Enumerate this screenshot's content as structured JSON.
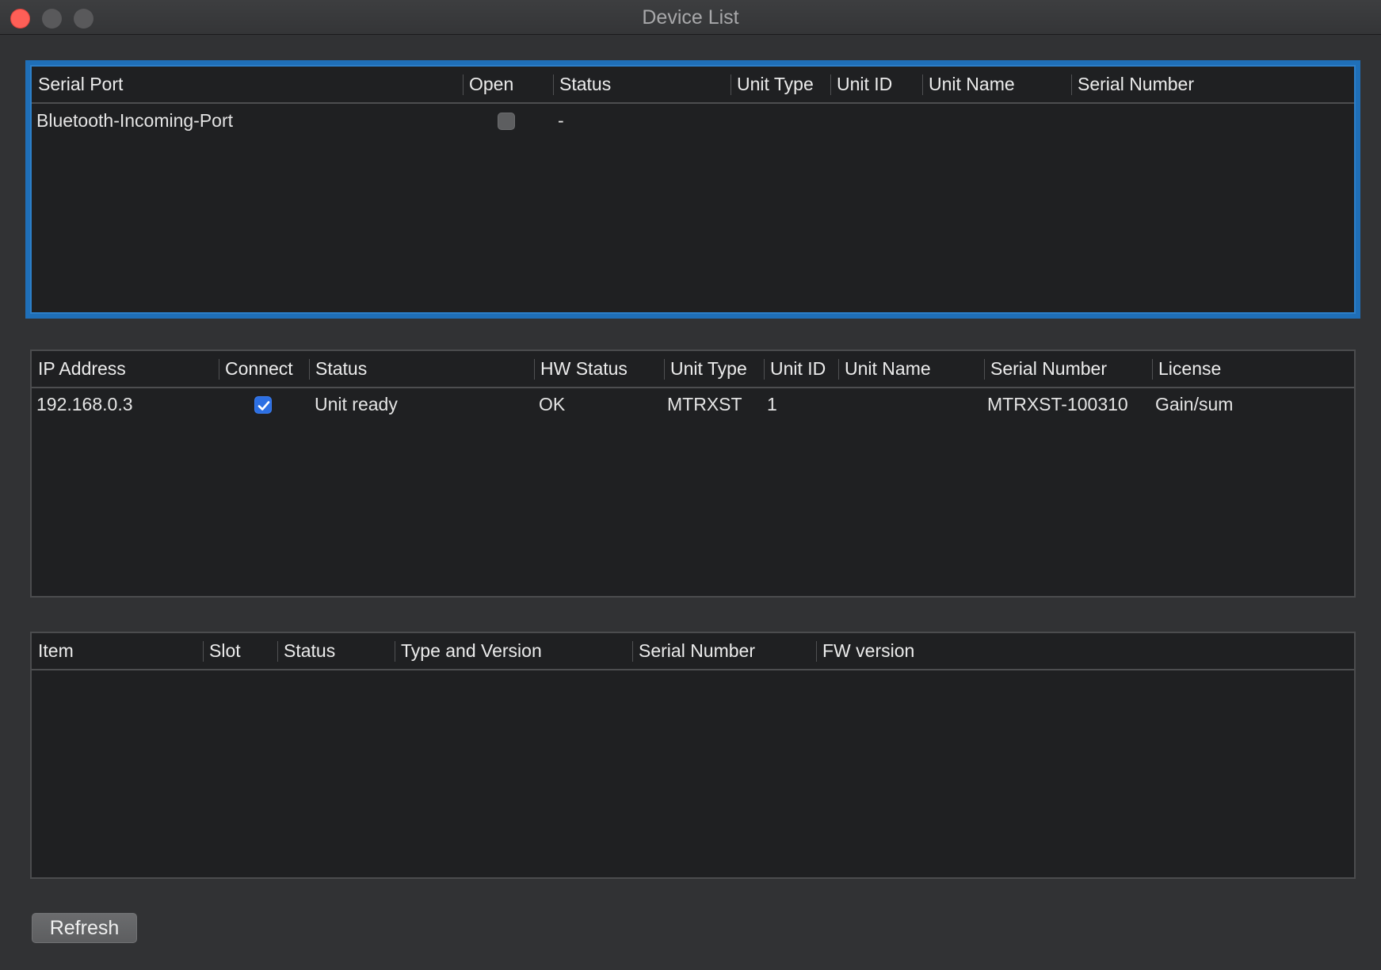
{
  "window": {
    "title": "Device List"
  },
  "serial_table": {
    "headers": [
      "Serial Port",
      "Open",
      "Status",
      "Unit Type",
      "Unit ID",
      "Unit Name",
      "Serial Number"
    ],
    "rows": [
      {
        "serial_port": "Bluetooth-Incoming-Port",
        "open": false,
        "status": "-",
        "unit_type": "",
        "unit_id": "",
        "unit_name": "",
        "serial_number": ""
      }
    ]
  },
  "ip_table": {
    "headers": [
      "IP Address",
      "Connect",
      "Status",
      "HW Status",
      "Unit Type",
      "Unit ID",
      "Unit Name",
      "Serial Number",
      "License"
    ],
    "rows": [
      {
        "ip_address": "192.168.0.3",
        "connect": true,
        "status": "Unit ready",
        "hw_status": "OK",
        "unit_type": "MTRXST",
        "unit_id": "1",
        "unit_name": "",
        "serial_number": "MTRXST-100310",
        "license": "Gain/sum"
      }
    ]
  },
  "items_table": {
    "headers": [
      "Item",
      "Slot",
      "Status",
      "Type and Version",
      "Serial Number",
      "FW version"
    ],
    "rows": []
  },
  "buttons": {
    "refresh": "Refresh"
  },
  "colors": {
    "accent": "#1f6fb8",
    "checkbox_on": "#2c6fe3",
    "close": "#fe5f57"
  }
}
